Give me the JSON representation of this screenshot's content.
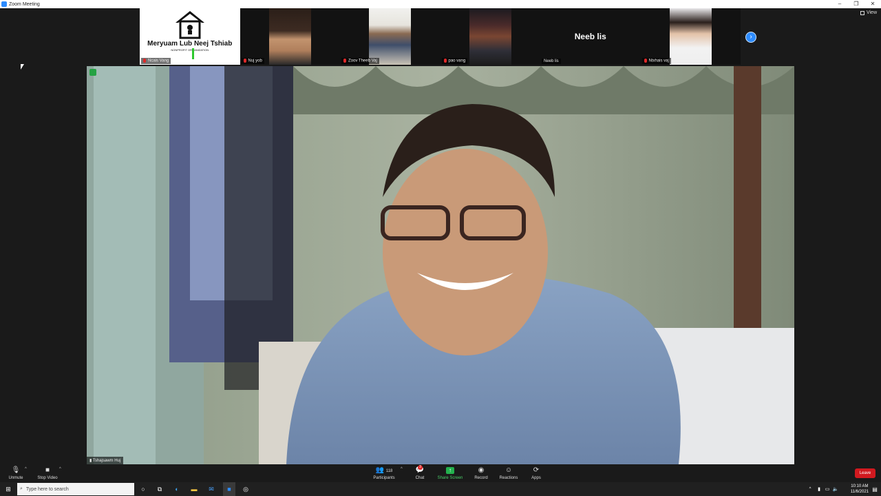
{
  "window": {
    "title": "Zoom Meeting",
    "view_label": "View"
  },
  "gallery": [
    {
      "name": "Ncais Vang",
      "type": "logo",
      "logo_text": "Meryuam Lub Neej Tshiab",
      "logo_sub": "NONPROFIT ORGANIZATION"
    },
    {
      "name": "Nuj yob",
      "type": "video"
    },
    {
      "name": "Zoov Theeb Vaj",
      "type": "video"
    },
    {
      "name": "pao vang",
      "type": "video"
    },
    {
      "name": "Neeb lis",
      "type": "name-only",
      "display": "Neeb lis"
    },
    {
      "name": "Ntxhais vaj",
      "type": "video"
    }
  ],
  "main_speaker": {
    "name": "Tshajsawm Huj"
  },
  "controls": {
    "unmute": "Unmute",
    "stop_video": "Stop Video",
    "participants": "Participants",
    "participants_count": "118",
    "chat": "Chat",
    "chat_badge": "3",
    "share_screen": "Share Screen",
    "record": "Record",
    "reactions": "Reactions",
    "apps": "Apps",
    "leave": "Leave"
  },
  "taskbar": {
    "search_placeholder": "Type here to search",
    "time": "10:10 AM",
    "date": "11/6/2021"
  }
}
